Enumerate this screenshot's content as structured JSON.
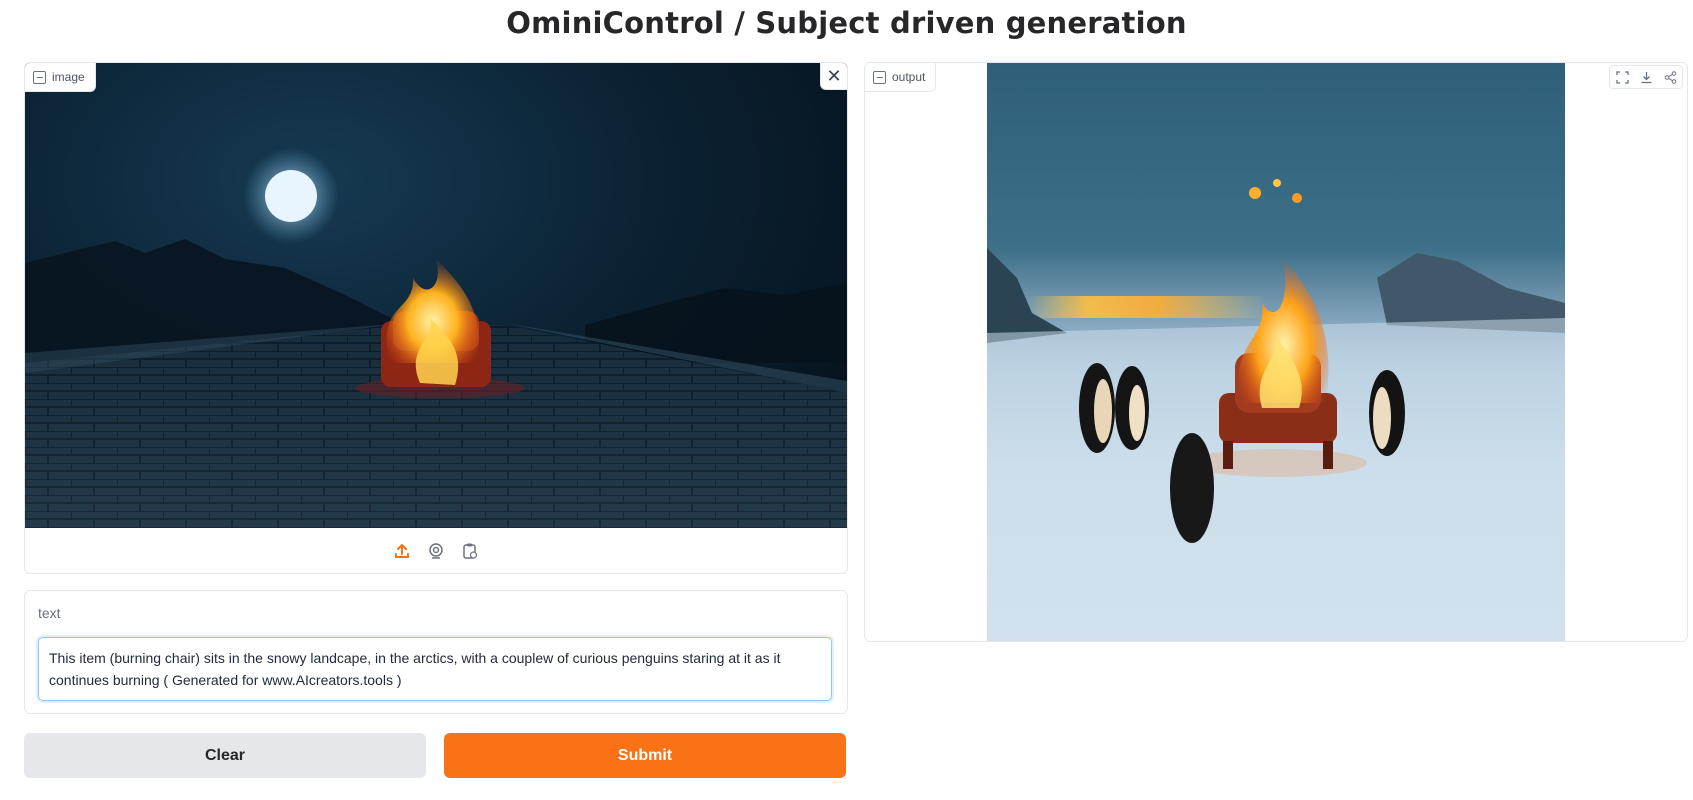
{
  "page": {
    "title": "OminiControl / Subject driven generation"
  },
  "image_input": {
    "label": "image",
    "close_icon": "close-icon",
    "source_icons": [
      "upload-icon",
      "webcam-icon",
      "clipboard-icon"
    ],
    "accent": "#f97316"
  },
  "text_input": {
    "label": "text",
    "value": "This item (burning chair) sits in the snowy landcape, in the arctics, with a couplew of curious penguins staring at it as it continues burning ( Generated for www.AIcreators.tools )"
  },
  "buttons": {
    "clear": "Clear",
    "submit": "Submit"
  },
  "output": {
    "label": "output",
    "tools": [
      "fullscreen-icon",
      "download-icon",
      "share-icon"
    ]
  }
}
